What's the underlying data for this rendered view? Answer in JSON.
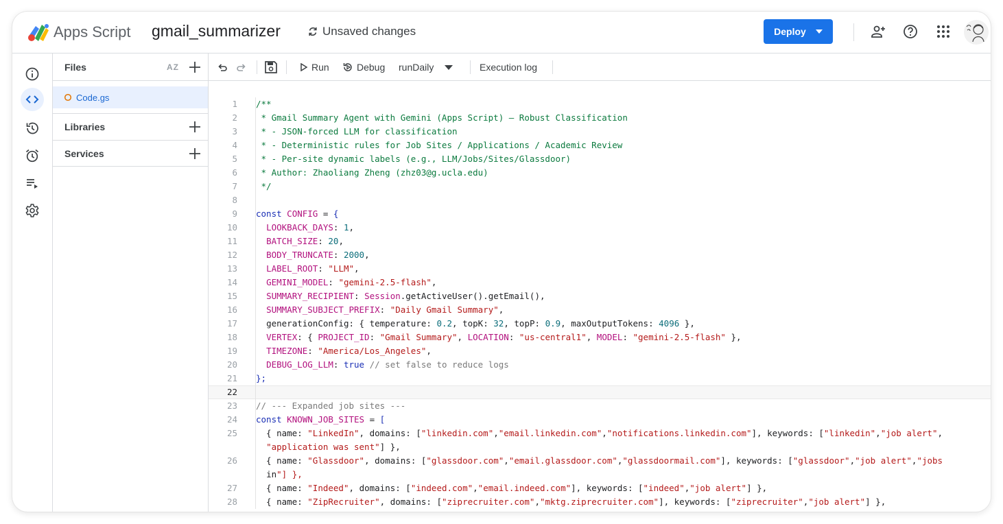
{
  "header": {
    "app_name": "Apps Script",
    "project_name": "gmail_summarizer",
    "status": "Unsaved changes",
    "deploy_label": "Deploy",
    "brand_color": "#1a73e8"
  },
  "rail": {
    "icons": [
      "info-icon",
      "code-icon",
      "history-icon",
      "alarm-icon",
      "executions-icon",
      "settings-icon"
    ]
  },
  "files_panel": {
    "title": "Files",
    "sort_label": "AZ",
    "file": "Code.gs",
    "libraries": "Libraries",
    "services": "Services"
  },
  "toolbar": {
    "run": "Run",
    "debug": "Debug",
    "function": "runDaily",
    "execution_log": "Execution log"
  },
  "code_lines": [
    {
      "n": "1",
      "t": "/**"
    },
    {
      "n": "2",
      "t": " * Gmail Summary Agent with Gemini (Apps Script) — Robust Classification"
    },
    {
      "n": "3",
      "t": " * - JSON-forced LLM for classification"
    },
    {
      "n": "4",
      "t": " * - Deterministic rules for Job Sites / Applications / Academic Review"
    },
    {
      "n": "5",
      "t": " * - Per-site dynamic labels (e.g., LLM/Jobs/Sites/Glassdoor)"
    },
    {
      "n": "6",
      "t": " * Author: Zhaoliang Zheng (zhz03@g.ucla.edu)"
    },
    {
      "n": "7",
      "t": " */"
    },
    {
      "n": "8",
      "t": ""
    },
    {
      "n": "9",
      "t": "const CONFIG = {"
    },
    {
      "n": "10",
      "t": "  LOOKBACK_DAYS: 1,"
    },
    {
      "n": "11",
      "t": "  BATCH_SIZE: 20,"
    },
    {
      "n": "12",
      "t": "  BODY_TRUNCATE: 2000,"
    },
    {
      "n": "13",
      "t": "  LABEL_ROOT: \"LLM\","
    },
    {
      "n": "14",
      "t": "  GEMINI_MODEL: \"gemini-2.5-flash\","
    },
    {
      "n": "15",
      "t": "  SUMMARY_RECIPIENT: Session.getActiveUser().getEmail(),"
    },
    {
      "n": "16",
      "t": "  SUMMARY_SUBJECT_PREFIX: \"Daily Gmail Summary\","
    },
    {
      "n": "17",
      "t": "  generationConfig: { temperature: 0.2, topK: 32, topP: 0.9, maxOutputTokens: 4096 },"
    },
    {
      "n": "18",
      "t": "  VERTEX: { PROJECT_ID: \"Gmail Summary\", LOCATION: \"us-central1\", MODEL: \"gemini-2.5-flash\" },"
    },
    {
      "n": "19",
      "t": "  TIMEZONE: \"America/Los_Angeles\","
    },
    {
      "n": "20",
      "t": "  DEBUG_LOG_LLM: true // set false to reduce logs"
    },
    {
      "n": "21",
      "t": "};"
    },
    {
      "n": "22",
      "t": ""
    },
    {
      "n": "23",
      "t": "// --- Expanded job sites ---"
    },
    {
      "n": "24",
      "t": "const KNOWN_JOB_SITES = ["
    },
    {
      "n": "25",
      "t": "  { name: \"LinkedIn\", domains: [\"linkedin.com\",\"email.linkedin.com\",\"notifications.linkedin.com\"], keywords: [\"linkedin\",\"job alert\","
    },
    {
      "n": "",
      "t": "  \"application was sent\"] },"
    },
    {
      "n": "26",
      "t": "  { name: \"Glassdoor\", domains: [\"glassdoor.com\",\"email.glassdoor.com\",\"glassdoormail.com\"], keywords: [\"glassdoor\",\"job alert\",\"jobs"
    },
    {
      "n": "",
      "t": "  in\"] },"
    },
    {
      "n": "27",
      "t": "  { name: \"Indeed\", domains: [\"indeed.com\",\"email.indeed.com\"], keywords: [\"indeed\",\"job alert\"] },"
    },
    {
      "n": "28",
      "t": "  { name: \"ZipRecruiter\", domains: [\"ziprecruiter.com\",\"mktg.ziprecruiter.com\"], keywords: [\"ziprecruiter\",\"job alert\"] },"
    }
  ],
  "highlighted_line": "22"
}
